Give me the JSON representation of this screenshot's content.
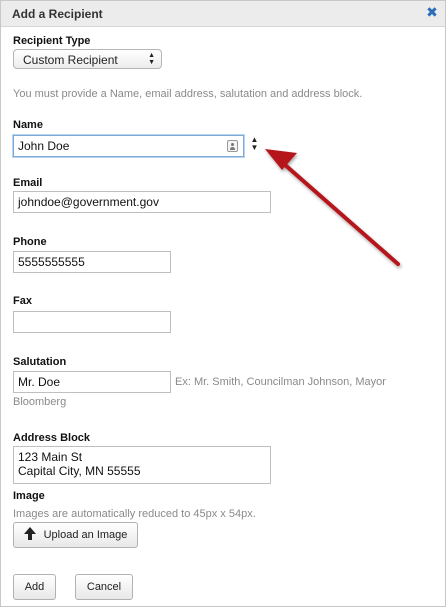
{
  "dialog": {
    "title": "Add a Recipient",
    "close_icon": "close-x-icon"
  },
  "recipient_type": {
    "label": "Recipient Type",
    "selected": "Custom Recipient"
  },
  "instruction": "You must provide a Name, email address, salutation and address block.",
  "name": {
    "label": "Name",
    "value": "John Doe"
  },
  "email": {
    "label": "Email",
    "value": "johndoe@government.gov"
  },
  "phone": {
    "label": "Phone",
    "value": "5555555555"
  },
  "fax": {
    "label": "Fax",
    "value": ""
  },
  "salutation": {
    "label": "Salutation",
    "value": "Mr. Doe",
    "example_line1": "Ex: Mr. Smith, Councilman Johnson, Mayor",
    "example_line2": "Bloomberg"
  },
  "address_block": {
    "label": "Address Block",
    "value": "123 Main St\nCapital City, MN 55555"
  },
  "image": {
    "label": "Image",
    "hint": "Images are automatically reduced to 45px x 54px.",
    "upload_label": "Upload an Image"
  },
  "actions": {
    "add_label": "Add",
    "cancel_label": "Cancel"
  },
  "colors": {
    "annotation_arrow": "#b5141c",
    "close_icon": "#2a6ebb"
  }
}
